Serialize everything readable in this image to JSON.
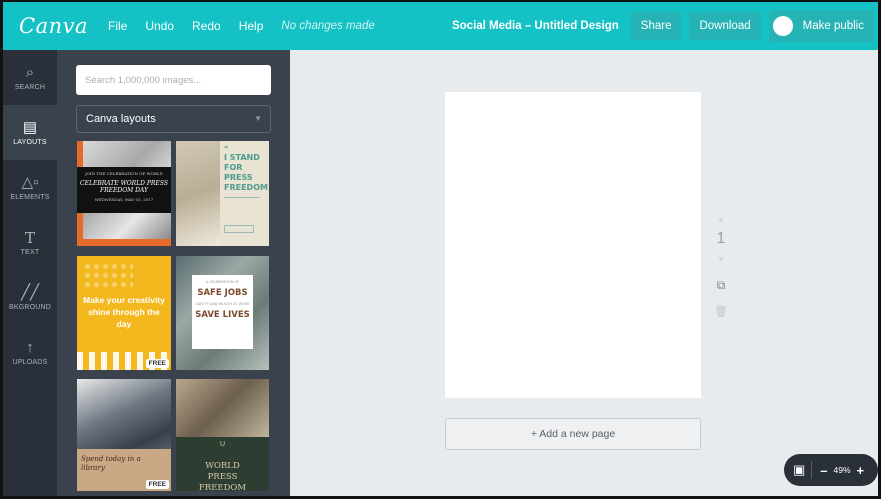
{
  "topbar": {
    "logo": "Canva",
    "menu": [
      "File",
      "Undo",
      "Redo",
      "Help"
    ],
    "status": "No changes made",
    "design_title": "Social Media – Untitled Design",
    "share_label": "Share",
    "download_label": "Download",
    "public_label": "Make public"
  },
  "rail": {
    "items": [
      {
        "label": "SEARCH",
        "icon": "search-icon"
      },
      {
        "label": "LAYOUTS",
        "icon": "layout-icon",
        "active": true
      },
      {
        "label": "ELEMENTS",
        "icon": "shapes-icon"
      },
      {
        "label": "TEXT",
        "icon": "text-icon"
      },
      {
        "label": "BKGROUND",
        "icon": "background-icon"
      },
      {
        "label": "UPLOADS",
        "icon": "upload-icon"
      }
    ]
  },
  "panel": {
    "search_placeholder": "Search 1,000,000 images...",
    "layout_select": "Canva layouts",
    "thumbs": {
      "t1": {
        "small": "JOIN THE CELEBRATION OF WORLD",
        "big": "CELEBRATE WORLD PRESS FREEDOM DAY",
        "date": "WEDNESDAY, MAY 03, 2017"
      },
      "t2": {
        "quote": "“",
        "text": "I STAND FOR PRESS FREEDOM!"
      },
      "t3": {
        "text": "Make your creativity shine through the day",
        "badge": "FREE"
      },
      "t4": {
        "small": "A CELEBRATION OF",
        "big1": "SAFE JOBS",
        "small2": "SAFETY AND HEALTH AT WORK",
        "big2": "SAVE LIVES"
      },
      "t5": {
        "text": "Spend today in a library",
        "badge": "FREE"
      },
      "t6": {
        "symbol": "U",
        "text": "WORLD PRESS FREEDOM DAY"
      }
    }
  },
  "canvas": {
    "page_number": "1",
    "add_page_label": "+ Add a new page"
  },
  "zoom": {
    "value": "49%",
    "minus": "–",
    "plus": "+"
  },
  "colors": {
    "brand": "#14c1c4",
    "rail": "#293039",
    "panel": "#3a424d",
    "workspace": "#e8ebee"
  }
}
